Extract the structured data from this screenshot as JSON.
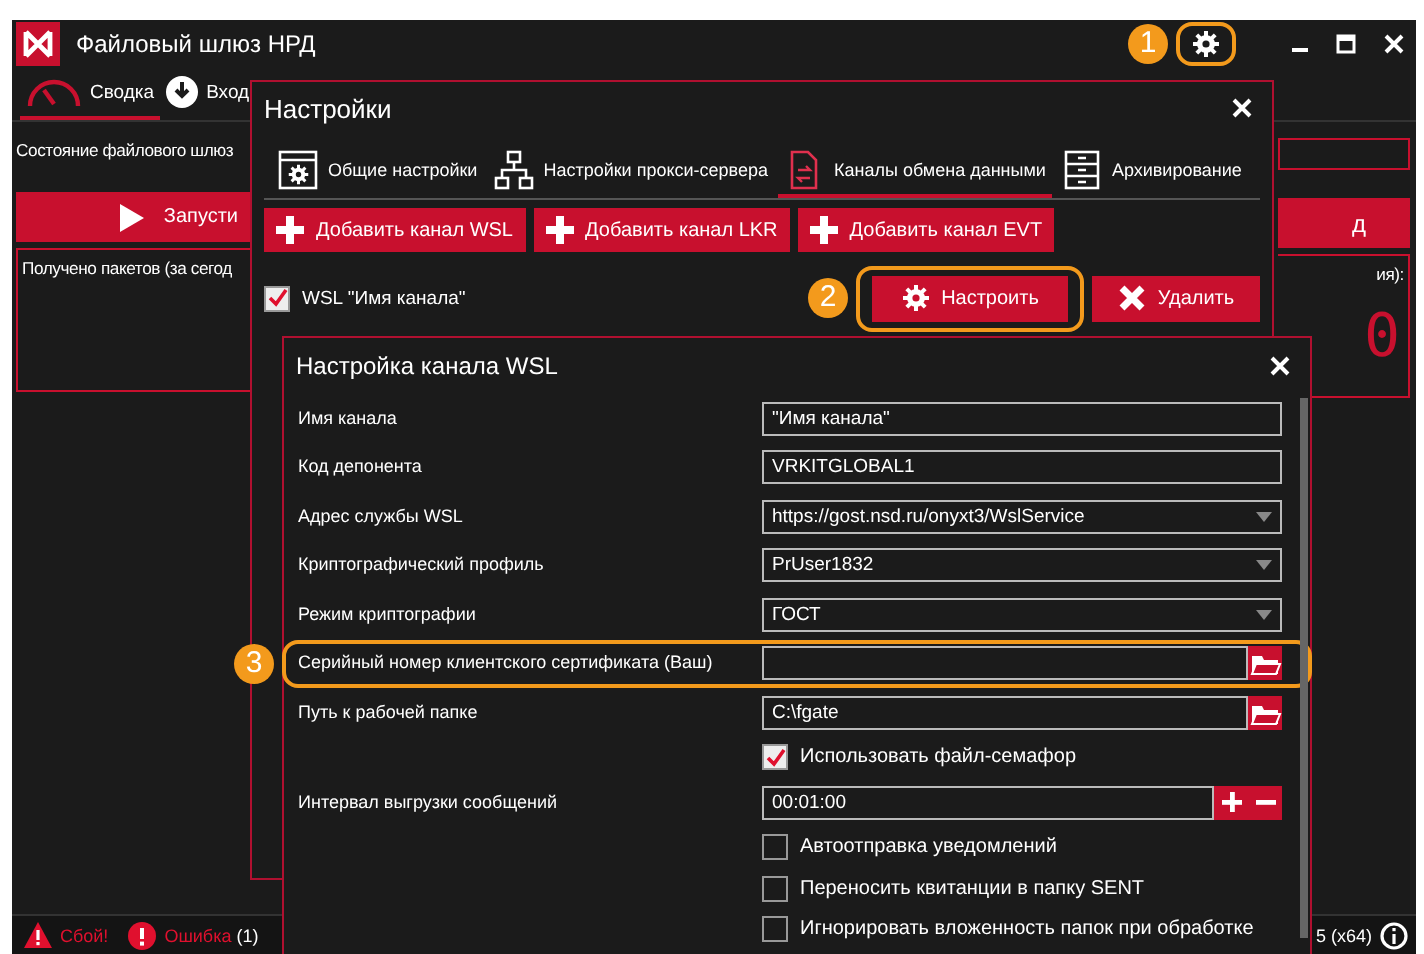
{
  "window": {
    "title": "Файловый шлюз НРД",
    "settings_button": {
      "highlighted": true,
      "callout": "1"
    }
  },
  "main_tabs": [
    {
      "label": "Сводка",
      "selected": true,
      "kind": "gauge"
    },
    {
      "label": "Вход",
      "selected": false,
      "kind": "download"
    }
  ],
  "status_label": "Состояние файлового шлюз",
  "start_button": "Запусти",
  "right_button": "д",
  "packets_label": "Получено пакетов (за сегод",
  "packets_right_label": "ия):",
  "counter": "0",
  "status_bar": {
    "failure": "Сбой!",
    "error": "Ошибка",
    "error_count": "(1)",
    "version": "5 (x64)"
  },
  "settings": {
    "title": "Настройки",
    "tabs": [
      {
        "label": "Общие настройки",
        "kind": "general",
        "selected": false
      },
      {
        "label": "Настройки прокси-сервера",
        "kind": "proxy",
        "selected": false
      },
      {
        "label": "Каналы обмена данными",
        "kind": "channels",
        "selected": true
      },
      {
        "label": "Архивирование",
        "kind": "archive",
        "selected": false
      }
    ],
    "add_buttons": [
      "Добавить канал WSL",
      "Добавить канал LKR",
      "Добавить канал EVT"
    ],
    "channels": [
      {
        "label": "WSL \"Имя канала\"",
        "checked": true
      }
    ],
    "configure_button": {
      "label": "Настроить",
      "highlighted": true,
      "callout": "2"
    },
    "delete_button": "Удалить"
  },
  "channel_dialog": {
    "title": "Настройка канала WSL",
    "fields": [
      {
        "kind": "text",
        "label": "Имя канала",
        "value": "\"Имя канала\""
      },
      {
        "kind": "text",
        "label": "Код депонента",
        "value": "VRKITGLOBAL1"
      },
      {
        "kind": "select",
        "label": "Адрес службы WSL",
        "value": "https://gost.nsd.ru/onyxt3/WslService"
      },
      {
        "kind": "select",
        "label": "Криптографический профиль",
        "value": "PrUser1832"
      },
      {
        "kind": "select",
        "label": "Режим криптографии",
        "value": "ГОСТ"
      },
      {
        "kind": "file",
        "label": "Серийный номер клиентского сертификата (Ваш)",
        "highlighted": true,
        "callout": "3"
      },
      {
        "kind": "file",
        "label": "Путь к рабочей папке",
        "value": "C:\\fgate"
      },
      {
        "kind": "checkbox",
        "label": "Использовать файл-семафор",
        "checked": true
      },
      {
        "kind": "spinner",
        "label": "Интервал выгрузки сообщений",
        "value": "00:01:00"
      },
      {
        "kind": "checkbox",
        "label": "Автоотправка уведомлений",
        "checked": false
      },
      {
        "kind": "checkbox",
        "label": "Переносить квитанции в папку SENT",
        "checked": false
      },
      {
        "kind": "checkbox",
        "label": "Игнорировать вложенность папок при обработке",
        "checked": false
      }
    ]
  }
}
